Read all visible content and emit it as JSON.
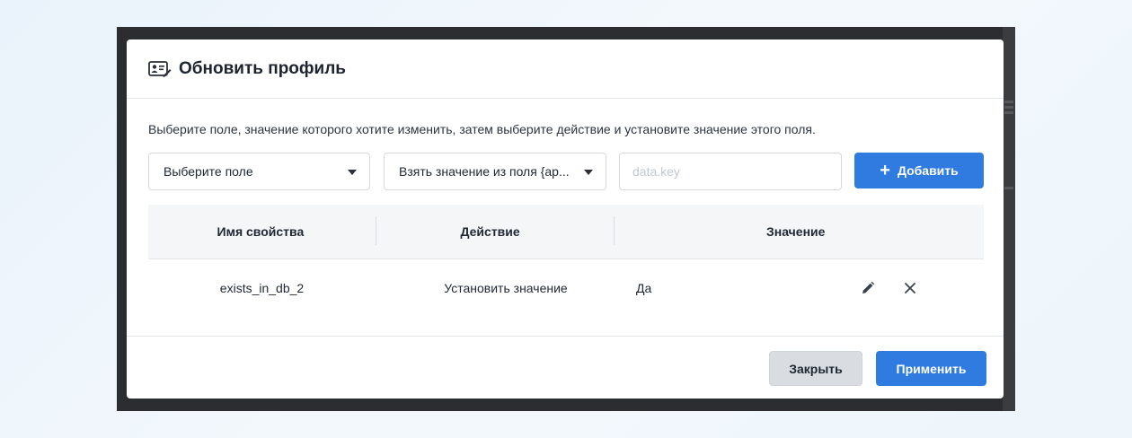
{
  "modal": {
    "title": "Обновить профиль",
    "title_icon": "profile-card-edit-icon",
    "hint": "Выберите поле, значение которого хотите изменить, затем выберите действие и установите значение этого поля."
  },
  "controls": {
    "field_select": "Выберите поле",
    "action_select": "Взять значение из поля {ар...",
    "value_placeholder": "data.key",
    "add_label": "Добавить"
  },
  "table": {
    "headers": [
      "Имя свойства",
      "Действие",
      "Значение"
    ],
    "rows": [
      {
        "property": "exists_in_db_2",
        "action": "Установить значение",
        "value": "Да"
      }
    ]
  },
  "footer": {
    "close_label": "Закрыть",
    "apply_label": "Применить"
  },
  "colors": {
    "accent": "#2f7be0",
    "backdrop": "#2b2d30"
  }
}
